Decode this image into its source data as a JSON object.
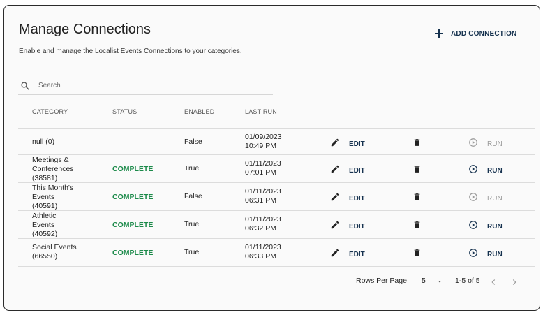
{
  "header": {
    "title": "Manage Connections",
    "subtitle": "Enable and manage the Localist Events Connections to your categories.",
    "add_label": "ADD CONNECTION"
  },
  "search": {
    "placeholder": "Search",
    "value": ""
  },
  "table": {
    "columns": [
      "CATEGORY",
      "STATUS",
      "ENABLED",
      "LAST RUN"
    ],
    "rows": [
      {
        "category": "null (0)",
        "status": "",
        "enabled": "False",
        "last_run_date": "01/09/2023",
        "last_run_time": "10:49 PM",
        "edit": "EDIT",
        "run": "RUN",
        "run_enabled": false
      },
      {
        "category_lines": [
          "Meetings &",
          "Conferences",
          "(38581)"
        ],
        "status": "COMPLETE",
        "enabled": "True",
        "last_run_date": "01/11/2023",
        "last_run_time": "07:01 PM",
        "edit": "EDIT",
        "run": "RUN",
        "run_enabled": true
      },
      {
        "category_lines": [
          "This Month's",
          "Events",
          "(40591)"
        ],
        "status": "COMPLETE",
        "enabled": "False",
        "last_run_date": "01/11/2023",
        "last_run_time": "06:31 PM",
        "edit": "EDIT",
        "run": "RUN",
        "run_enabled": false
      },
      {
        "category_lines": [
          "Athletic",
          "Events",
          "(40592)"
        ],
        "status": "COMPLETE",
        "enabled": "True",
        "last_run_date": "01/11/2023",
        "last_run_time": "06:32 PM",
        "edit": "EDIT",
        "run": "RUN",
        "run_enabled": true
      },
      {
        "category_lines": [
          "Social Events",
          "(66550)"
        ],
        "status": "COMPLETE",
        "enabled": "True",
        "last_run_date": "01/11/2023",
        "last_run_time": "06:33 PM",
        "edit": "EDIT",
        "run": "RUN",
        "run_enabled": true
      }
    ]
  },
  "pagination": {
    "rows_per_page_label": "Rows Per Page",
    "rows_per_page": "5",
    "range": "1-5 of 5"
  },
  "colors": {
    "accent": "#16324f",
    "complete": "#1c8a4a",
    "disabled": "#9a9a9a"
  }
}
